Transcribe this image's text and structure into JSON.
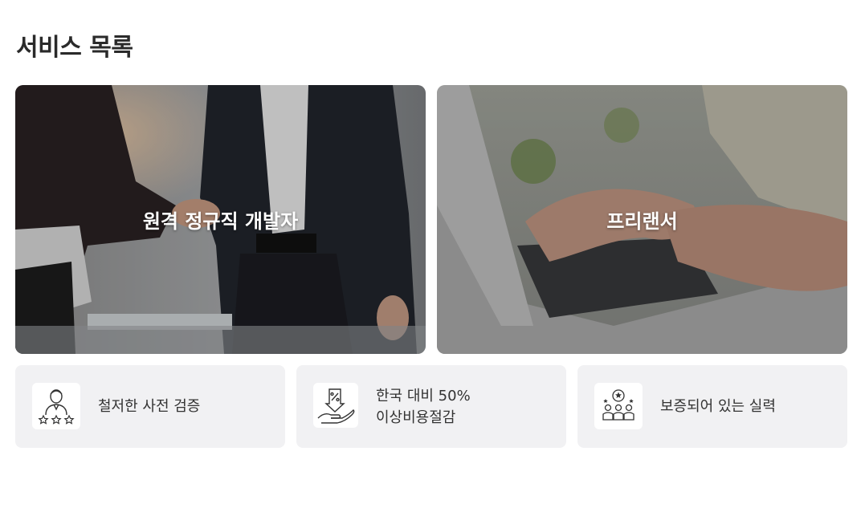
{
  "page": {
    "title": "서비스 목록"
  },
  "services": [
    {
      "label": "원격 정규직 개발자"
    },
    {
      "label": "프리랜서"
    }
  ],
  "features": [
    {
      "icon": "verified-person-stars-icon",
      "line1": "철저한 사전 검증",
      "line2": ""
    },
    {
      "icon": "discount-hand-icon",
      "line1": "한국 대비 50%",
      "line2": "이상비용절감"
    },
    {
      "icon": "team-award-icon",
      "line1": "보증되어 있는 실력",
      "line2": ""
    }
  ],
  "colors": {
    "card_bg": "#f1f1f3",
    "overlay": "#000000",
    "text": "#333333"
  }
}
